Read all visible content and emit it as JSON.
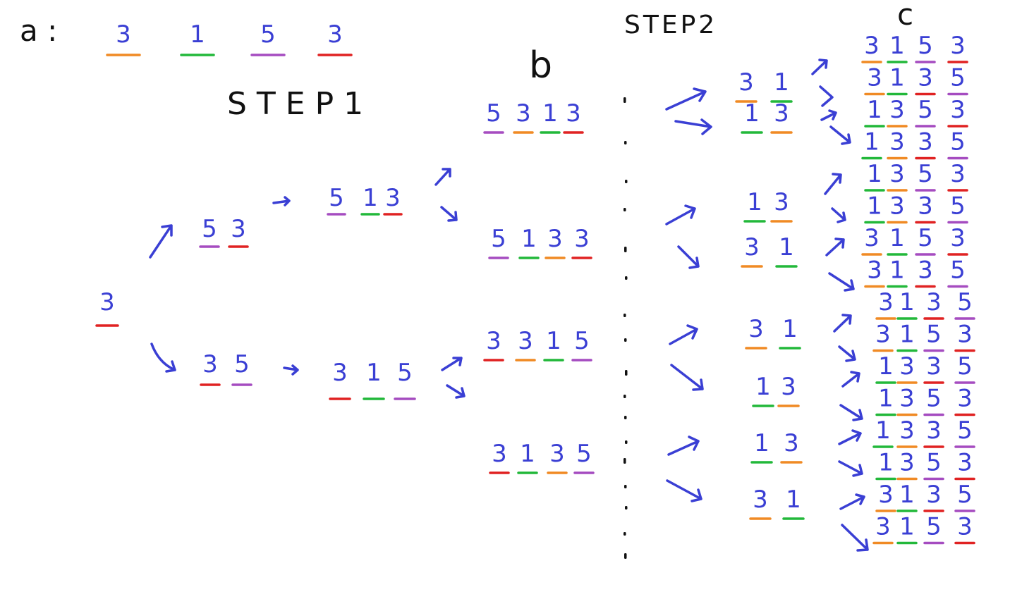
{
  "labels": {
    "a": "a :",
    "b": "b",
    "c": "c",
    "step1": "STEP1",
    "step2": "STEP2"
  },
  "colors": {
    "digit": "#3a3fd4",
    "orange": "#f08a24",
    "green": "#22b83a",
    "purple": "#a54cc0",
    "red": "#e02222",
    "text": "#111111"
  },
  "sequence_a": [
    {
      "digit": "3",
      "color": "orange"
    },
    {
      "digit": "1",
      "color": "green"
    },
    {
      "digit": "5",
      "color": "purple"
    },
    {
      "digit": "3",
      "color": "red"
    }
  ],
  "step1_tree": {
    "root": {
      "digit": "3",
      "color": "red"
    },
    "level1": [
      [
        {
          "digit": "5",
          "color": "purple"
        },
        {
          "digit": "3",
          "color": "red"
        }
      ],
      [
        {
          "digit": "3",
          "color": "red"
        },
        {
          "digit": "5",
          "color": "purple"
        }
      ]
    ],
    "level2": [
      [
        {
          "digit": "5",
          "color": "purple"
        },
        {
          "digit": "1",
          "color": "green"
        },
        {
          "digit": "3",
          "color": "red"
        }
      ],
      [
        {
          "digit": "3",
          "color": "red"
        },
        {
          "digit": "1",
          "color": "green"
        },
        {
          "digit": "5",
          "color": "purple"
        }
      ]
    ]
  },
  "column_b": [
    [
      {
        "digit": "5",
        "color": "purple"
      },
      {
        "digit": "3",
        "color": "orange"
      },
      {
        "digit": "1",
        "color": "green"
      },
      {
        "digit": "3",
        "color": "red"
      }
    ],
    [
      {
        "digit": "5",
        "color": "purple"
      },
      {
        "digit": "1",
        "color": "green"
      },
      {
        "digit": "3",
        "color": "orange"
      },
      {
        "digit": "3",
        "color": "red"
      }
    ],
    [
      {
        "digit": "3",
        "color": "red"
      },
      {
        "digit": "3",
        "color": "orange"
      },
      {
        "digit": "1",
        "color": "green"
      },
      {
        "digit": "5",
        "color": "purple"
      }
    ],
    [
      {
        "digit": "3",
        "color": "red"
      },
      {
        "digit": "1",
        "color": "green"
      },
      {
        "digit": "3",
        "color": "orange"
      },
      {
        "digit": "5",
        "color": "purple"
      }
    ]
  ],
  "step2_pairs": [
    [
      {
        "digit": "3",
        "color": "orange"
      },
      {
        "digit": "1",
        "color": "green"
      }
    ],
    [
      {
        "digit": "1",
        "color": "green"
      },
      {
        "digit": "3",
        "color": "orange"
      }
    ],
    [
      {
        "digit": "1",
        "color": "green"
      },
      {
        "digit": "3",
        "color": "orange"
      }
    ],
    [
      {
        "digit": "3",
        "color": "orange"
      },
      {
        "digit": "1",
        "color": "green"
      }
    ],
    [
      {
        "digit": "3",
        "color": "orange"
      },
      {
        "digit": "1",
        "color": "green"
      }
    ],
    [
      {
        "digit": "1",
        "color": "green"
      },
      {
        "digit": "3",
        "color": "orange"
      }
    ],
    [
      {
        "digit": "1",
        "color": "green"
      },
      {
        "digit": "3",
        "color": "orange"
      }
    ],
    [
      {
        "digit": "3",
        "color": "orange"
      },
      {
        "digit": "1",
        "color": "green"
      }
    ]
  ],
  "column_c": [
    [
      {
        "digit": "3",
        "color": "orange"
      },
      {
        "digit": "1",
        "color": "green"
      },
      {
        "digit": "5",
        "color": "purple"
      },
      {
        "digit": "3",
        "color": "red"
      }
    ],
    [
      {
        "digit": "3",
        "color": "orange"
      },
      {
        "digit": "1",
        "color": "green"
      },
      {
        "digit": "3",
        "color": "red"
      },
      {
        "digit": "5",
        "color": "purple"
      }
    ],
    [
      {
        "digit": "1",
        "color": "green"
      },
      {
        "digit": "3",
        "color": "orange"
      },
      {
        "digit": "5",
        "color": "purple"
      },
      {
        "digit": "3",
        "color": "red"
      }
    ],
    [
      {
        "digit": "1",
        "color": "green"
      },
      {
        "digit": "3",
        "color": "orange"
      },
      {
        "digit": "3",
        "color": "red"
      },
      {
        "digit": "5",
        "color": "purple"
      }
    ],
    [
      {
        "digit": "1",
        "color": "green"
      },
      {
        "digit": "3",
        "color": "orange"
      },
      {
        "digit": "5",
        "color": "purple"
      },
      {
        "digit": "3",
        "color": "red"
      }
    ],
    [
      {
        "digit": "1",
        "color": "green"
      },
      {
        "digit": "3",
        "color": "orange"
      },
      {
        "digit": "3",
        "color": "red"
      },
      {
        "digit": "5",
        "color": "purple"
      }
    ],
    [
      {
        "digit": "3",
        "color": "orange"
      },
      {
        "digit": "1",
        "color": "green"
      },
      {
        "digit": "5",
        "color": "purple"
      },
      {
        "digit": "3",
        "color": "red"
      }
    ],
    [
      {
        "digit": "3",
        "color": "orange"
      },
      {
        "digit": "1",
        "color": "green"
      },
      {
        "digit": "3",
        "color": "red"
      },
      {
        "digit": "5",
        "color": "purple"
      }
    ],
    [
      {
        "digit": "3",
        "color": "orange"
      },
      {
        "digit": "1",
        "color": "green"
      },
      {
        "digit": "3",
        "color": "red"
      },
      {
        "digit": "5",
        "color": "purple"
      }
    ],
    [
      {
        "digit": "3",
        "color": "orange"
      },
      {
        "digit": "1",
        "color": "green"
      },
      {
        "digit": "5",
        "color": "purple"
      },
      {
        "digit": "3",
        "color": "red"
      }
    ],
    [
      {
        "digit": "1",
        "color": "green"
      },
      {
        "digit": "3",
        "color": "orange"
      },
      {
        "digit": "3",
        "color": "red"
      },
      {
        "digit": "5",
        "color": "purple"
      }
    ],
    [
      {
        "digit": "1",
        "color": "green"
      },
      {
        "digit": "3",
        "color": "orange"
      },
      {
        "digit": "5",
        "color": "purple"
      },
      {
        "digit": "3",
        "color": "red"
      }
    ],
    [
      {
        "digit": "1",
        "color": "green"
      },
      {
        "digit": "3",
        "color": "orange"
      },
      {
        "digit": "3",
        "color": "red"
      },
      {
        "digit": "5",
        "color": "purple"
      }
    ],
    [
      {
        "digit": "1",
        "color": "green"
      },
      {
        "digit": "3",
        "color": "orange"
      },
      {
        "digit": "5",
        "color": "purple"
      },
      {
        "digit": "3",
        "color": "red"
      }
    ],
    [
      {
        "digit": "3",
        "color": "orange"
      },
      {
        "digit": "1",
        "color": "green"
      },
      {
        "digit": "3",
        "color": "red"
      },
      {
        "digit": "5",
        "color": "purple"
      }
    ],
    [
      {
        "digit": "3",
        "color": "orange"
      },
      {
        "digit": "1",
        "color": "green"
      },
      {
        "digit": "5",
        "color": "purple"
      },
      {
        "digit": "3",
        "color": "red"
      }
    ]
  ]
}
